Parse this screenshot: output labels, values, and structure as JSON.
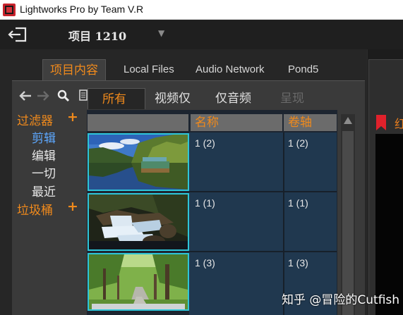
{
  "window": {
    "title": "Lightworks Pro by Team V.R"
  },
  "project": {
    "name": "项目 1210"
  },
  "tabs": [
    {
      "label": "项目内容"
    },
    {
      "label": "Local Files"
    },
    {
      "label": "Audio Network"
    },
    {
      "label": "Pond5"
    }
  ],
  "sidebar": {
    "filters_label": "过滤器",
    "items": [
      {
        "label": "剪辑"
      },
      {
        "label": "编辑"
      },
      {
        "label": "一切"
      },
      {
        "label": "最近"
      }
    ],
    "trash_label": "垃圾桶",
    "plus": "+"
  },
  "subtabs": [
    {
      "label": "所有"
    },
    {
      "label": "视频仅"
    },
    {
      "label": "仅音频"
    },
    {
      "label": "呈现"
    }
  ],
  "table": {
    "columns": [
      "名称",
      "卷轴"
    ],
    "rows": [
      {
        "name": "1 (2)",
        "reel": "1 (2)",
        "thumb": "lake-with-boat"
      },
      {
        "name": "1 (1)",
        "reel": "1 (1)",
        "thumb": "waterfall"
      },
      {
        "name": "1 (3)",
        "reel": "1 (3)",
        "thumb": "tree-lined-path"
      }
    ]
  },
  "right_panel": {
    "label": "红"
  },
  "watermark": "知乎 @冒险的Cutfish",
  "colors": {
    "accent": "#f08a1c",
    "selected_item": "#5da8ff",
    "thumb_border": "#2ec5d8",
    "row_bg": "#20384f"
  }
}
